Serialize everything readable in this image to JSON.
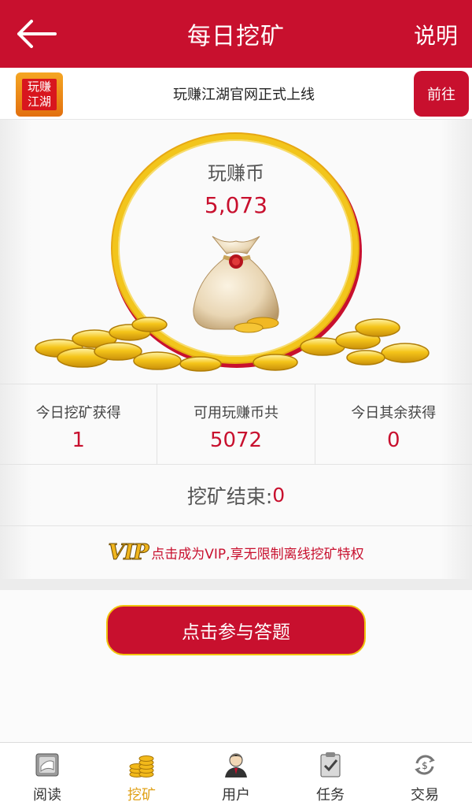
{
  "header": {
    "title": "每日挖矿",
    "help_label": "说明"
  },
  "announcement": {
    "logo_line1": "玩赚",
    "logo_line2": "江湖",
    "text": "玩赚江湖官网正式上线",
    "go_label": "前往"
  },
  "coin": {
    "label": "玩赚币",
    "value": "5,073"
  },
  "stats": [
    {
      "label": "今日挖矿获得",
      "value": "1"
    },
    {
      "label": "可用玩赚币共",
      "value": "5072"
    },
    {
      "label": "今日其余获得",
      "value": "0"
    }
  ],
  "mining_end": {
    "label": "挖矿结束:",
    "value": "0"
  },
  "vip": {
    "badge": "VIP",
    "text": "点击成为VIP,享无限制离线挖矿特权"
  },
  "answer_button": "点击参与答题",
  "nav": [
    {
      "label": "阅读",
      "icon": "book-icon",
      "active": false
    },
    {
      "label": "挖矿",
      "icon": "coin-stack-icon",
      "active": true
    },
    {
      "label": "用户",
      "icon": "user-icon",
      "active": false
    },
    {
      "label": "任务",
      "icon": "task-icon",
      "active": false
    },
    {
      "label": "交易",
      "icon": "exchange-icon",
      "active": false
    }
  ],
  "colors": {
    "brand_red": "#c8102e",
    "gold": "#f2c51c",
    "active_nav": "#e0a21a"
  }
}
